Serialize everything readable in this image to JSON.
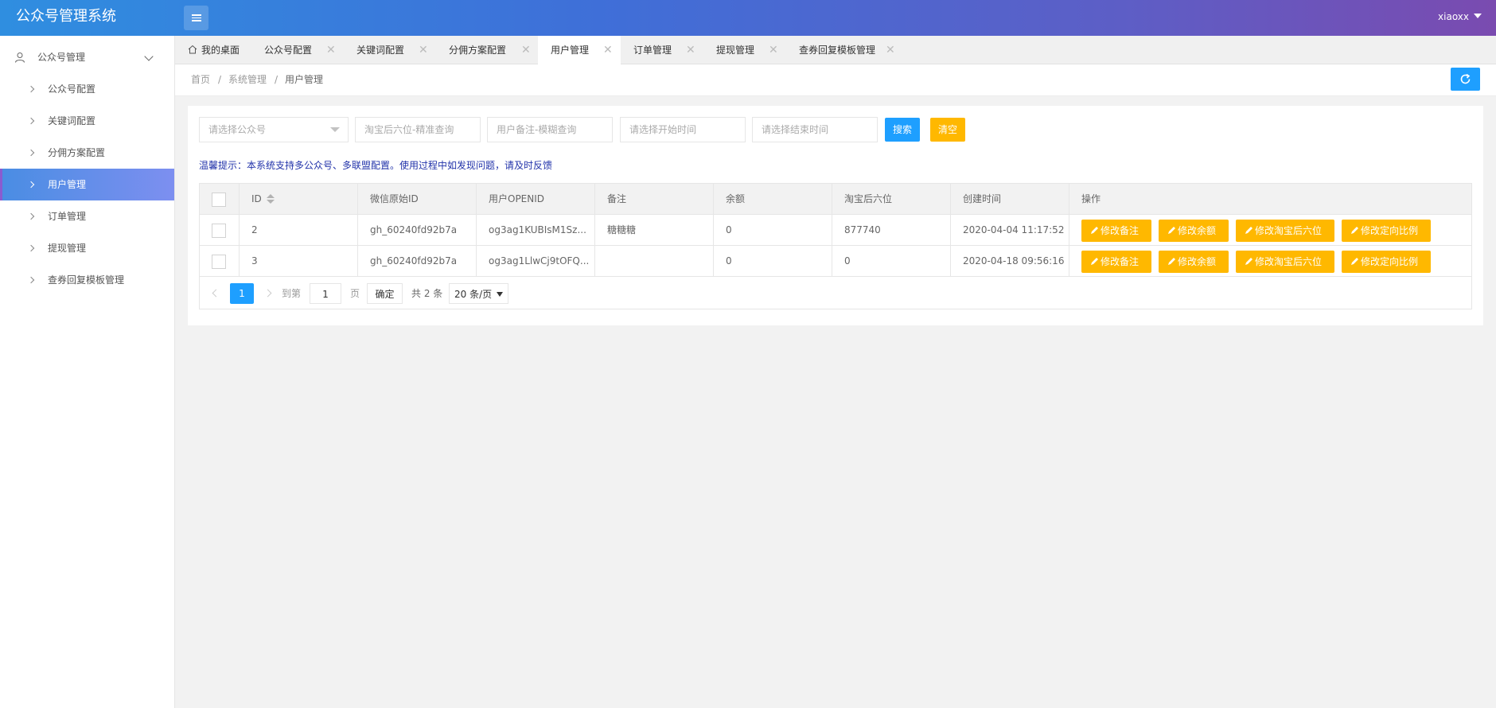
{
  "app": {
    "title": "公众号管理系统",
    "user": "xiaoxx"
  },
  "sidebar": {
    "group_label": "公众号管理",
    "items": [
      {
        "label": "公众号配置"
      },
      {
        "label": "关键词配置"
      },
      {
        "label": "分佣方案配置"
      },
      {
        "label": "用户管理",
        "active": true
      },
      {
        "label": "订单管理"
      },
      {
        "label": "提现管理"
      },
      {
        "label": "查券回复模板管理"
      }
    ]
  },
  "tabs": [
    {
      "label": "我的桌面"
    },
    {
      "label": "公众号配置"
    },
    {
      "label": "关键词配置"
    },
    {
      "label": "分佣方案配置"
    },
    {
      "label": "用户管理",
      "active": true
    },
    {
      "label": "订单管理"
    },
    {
      "label": "提现管理"
    },
    {
      "label": "查券回复模板管理"
    }
  ],
  "tab_close": "✕",
  "breadcrumb": {
    "items": [
      "首页",
      "系统管理",
      "用户管理"
    ],
    "sep": "/"
  },
  "filters": {
    "account_select_placeholder": "请选择公众号",
    "taobao_placeholder": "淘宝后六位-精准查询",
    "remark_placeholder": "用户备注-模糊查询",
    "start_placeholder": "请选择开始时间",
    "end_placeholder": "请选择结束时间",
    "search_label": "搜索",
    "clear_label": "清空"
  },
  "tip": "温馨提示：本系统支持多公众号、多联盟配置。使用过程中如发现问题，请及时反馈",
  "table": {
    "columns": [
      "ID",
      "微信原始ID",
      "用户OPENID",
      "备注",
      "余额",
      "淘宝后六位",
      "创建时间",
      "操作"
    ],
    "rows": [
      {
        "id": "2",
        "wx_id": "gh_60240fd92b7a",
        "openid": "og3ag1KUBIsM1Sz...",
        "remark": "糖糖糖",
        "balance": "0",
        "taobao": "877740",
        "created": "2020-04-04 11:17:52"
      },
      {
        "id": "3",
        "wx_id": "gh_60240fd92b7a",
        "openid": "og3ag1LlwCj9tOFQ...",
        "remark": "",
        "balance": "0",
        "taobao": "0",
        "created": "2020-04-18 09:56:16"
      }
    ],
    "actions": [
      "修改备注",
      "修改余额",
      "修改淘宝后六位",
      "修改定向比例"
    ]
  },
  "pager": {
    "current": "1",
    "goto_label": "到第",
    "goto_value": "1",
    "page_unit": "页",
    "confirm": "确定",
    "total": "共 2 条",
    "page_size": "20 条/页"
  },
  "colors": {
    "accent_blue": "#1e9fff",
    "action_yellow": "#ffb800",
    "sidebar_active": "#4a8de3"
  }
}
